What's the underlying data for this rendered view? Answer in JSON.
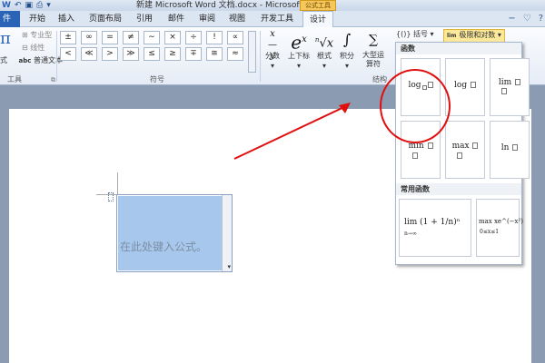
{
  "titlebar": {
    "qat_icons": [
      "word-icon",
      "undo-icon",
      "save-icon",
      "print-icon"
    ],
    "window_title": "新建 Microsoft Word 文档.docx - Microsoft Word",
    "context_tab": "公式工具"
  },
  "tabs": {
    "file": "件",
    "items": [
      "开始",
      "插入",
      "页面布局",
      "引用",
      "邮件",
      "审阅",
      "视图",
      "开发工具",
      "设计"
    ],
    "active": "设计"
  },
  "window_controls": [
    "−",
    "♡",
    "?"
  ],
  "ribbon": {
    "tools": {
      "professional": "专业型",
      "linear": "线性",
      "normal_text": "普通文本",
      "abc": "abc",
      "ti": "式",
      "group_label": "工具"
    },
    "symbols": {
      "items": [
        "±",
        "∞",
        "=",
        "≠",
        "∼",
        "×",
        "÷",
        "!",
        "∝",
        "<",
        "≪",
        ">",
        "≫",
        "≤",
        "≥",
        "∓",
        "≅",
        "≈",
        "≡",
        "∀"
      ],
      "group_label": "符号"
    },
    "structures": [
      {
        "label": "分数",
        "sub": "▾",
        "glyph": "x⁄y"
      },
      {
        "label": "上下标",
        "sub": "▾",
        "glyph": "eˣ"
      },
      {
        "label": "根式",
        "sub": "▾",
        "glyph": "ⁿ√x"
      },
      {
        "label": "积分",
        "sub": "▾",
        "glyph": "∫ˣ₋ₓ"
      },
      {
        "label": "大型运算符",
        "sub": "▾",
        "glyph": "∑"
      }
    ],
    "structure_group_label": "结构",
    "bracket_menu": "{()} 括号 ▾",
    "limit_menu": "极限和对数 ▾"
  },
  "dropdown": {
    "section1": "函数",
    "functions": [
      {
        "name": "log",
        "kind": "log-sub"
      },
      {
        "name": "log",
        "kind": "plain"
      },
      {
        "name": "lim",
        "kind": "lim-sub"
      },
      {
        "name": "min",
        "kind": "min-sub"
      },
      {
        "name": "max",
        "kind": "max-sub"
      },
      {
        "name": "ln",
        "kind": "plain"
      }
    ],
    "section2": "常用函数",
    "common": [
      {
        "text": "lim (1 + 1/n)ⁿ",
        "sub": "n→∞"
      },
      {
        "text": "max xe^(−x²)",
        "sub": "0≤x≤1"
      }
    ]
  },
  "document": {
    "equation_placeholder": "在此处键入公式。"
  },
  "annotation_color": "#e01010"
}
